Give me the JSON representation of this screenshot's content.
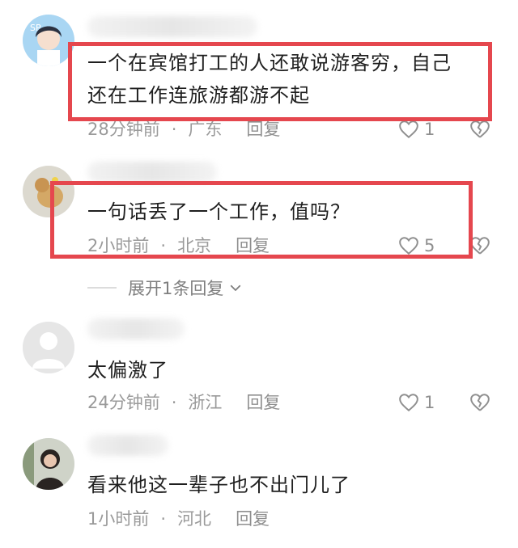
{
  "comments": [
    {
      "text_line1": "一个在宾馆打工的人还敢说游客穷，自己",
      "text_line2": "还在工作连旅游都游不起",
      "time": "28分钟前",
      "location": "广东",
      "reply": "回复",
      "likes": "1"
    },
    {
      "text": "一句话丢了一个工作，值吗？",
      "time": "2小时前",
      "location": "北京",
      "reply": "回复",
      "likes": "5",
      "expand": "展开1条回复"
    },
    {
      "text": "太偏激了",
      "time": "24分钟前",
      "location": "浙江",
      "reply": "回复",
      "likes": "1"
    },
    {
      "text": "看来他这一辈子也不出门儿了",
      "time": "1小时前",
      "location": "河北",
      "reply": "回复"
    }
  ],
  "separator": "·",
  "avatar_badge": "SP",
  "colors": {
    "highlight": "#e5474e",
    "meta": "#9a9a9a"
  }
}
